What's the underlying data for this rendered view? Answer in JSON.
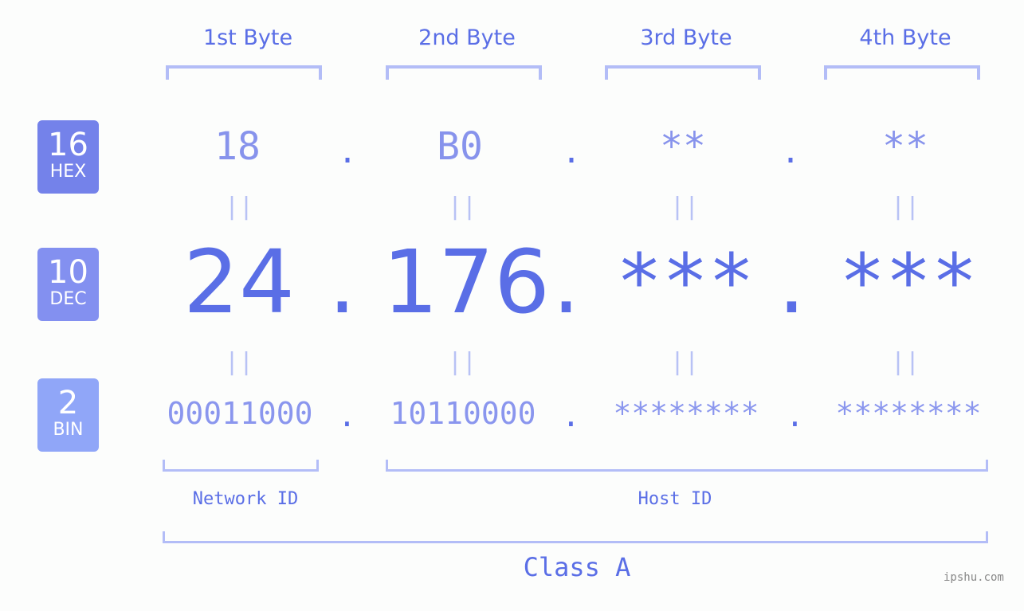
{
  "bytes": [
    {
      "header": "1st Byte",
      "hex": "18",
      "dec": "24",
      "bin": "00011000"
    },
    {
      "header": "2nd Byte",
      "hex": "B0",
      "dec": "176",
      "bin": "10110000"
    },
    {
      "header": "3rd Byte",
      "hex": "**",
      "dec": "***",
      "bin": "********"
    },
    {
      "header": "4th Byte",
      "hex": "**",
      "dec": "***",
      "bin": "********"
    }
  ],
  "badges": {
    "hex": {
      "num": "16",
      "label": "HEX",
      "color": "#7482ea"
    },
    "dec": {
      "num": "10",
      "label": "DEC",
      "color": "#8390f0"
    },
    "bin": {
      "num": "2",
      "label": "BIN",
      "color": "#90a6f8"
    }
  },
  "separator": ".",
  "equals": "||",
  "labels": {
    "network": "Network ID",
    "host": "Host ID",
    "class": "Class A"
  },
  "watermark": "ipshu.com"
}
